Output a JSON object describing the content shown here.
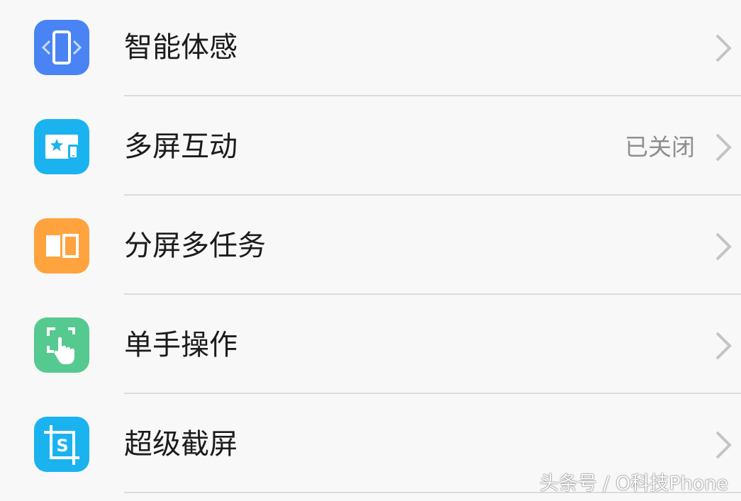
{
  "colors": {
    "background": "#f8f8f8",
    "label_text": "#1c1c1c",
    "value_text": "#8f8f8f",
    "divider": "#dcdcdc",
    "chevron": "#c4c4c4"
  },
  "settings": {
    "items": [
      {
        "label": "智能体感",
        "value": "",
        "icon": "phone-motion-icon",
        "icon_color": "#4a84f4"
      },
      {
        "label": "多屏互动",
        "value": "已关闭",
        "icon": "multi-screen-icon",
        "icon_color": "#1ab3ef"
      },
      {
        "label": "分屏多任务",
        "value": "",
        "icon": "split-screen-icon",
        "icon_color": "#ffa33f"
      },
      {
        "label": "单手操作",
        "value": "",
        "icon": "one-hand-icon",
        "icon_color": "#55c98f"
      },
      {
        "label": "超级截屏",
        "value": "",
        "icon": "super-screenshot-icon",
        "icon_color": "#1ab3ef"
      }
    ]
  },
  "watermark": {
    "text": "头条号 / O科技Phone"
  }
}
